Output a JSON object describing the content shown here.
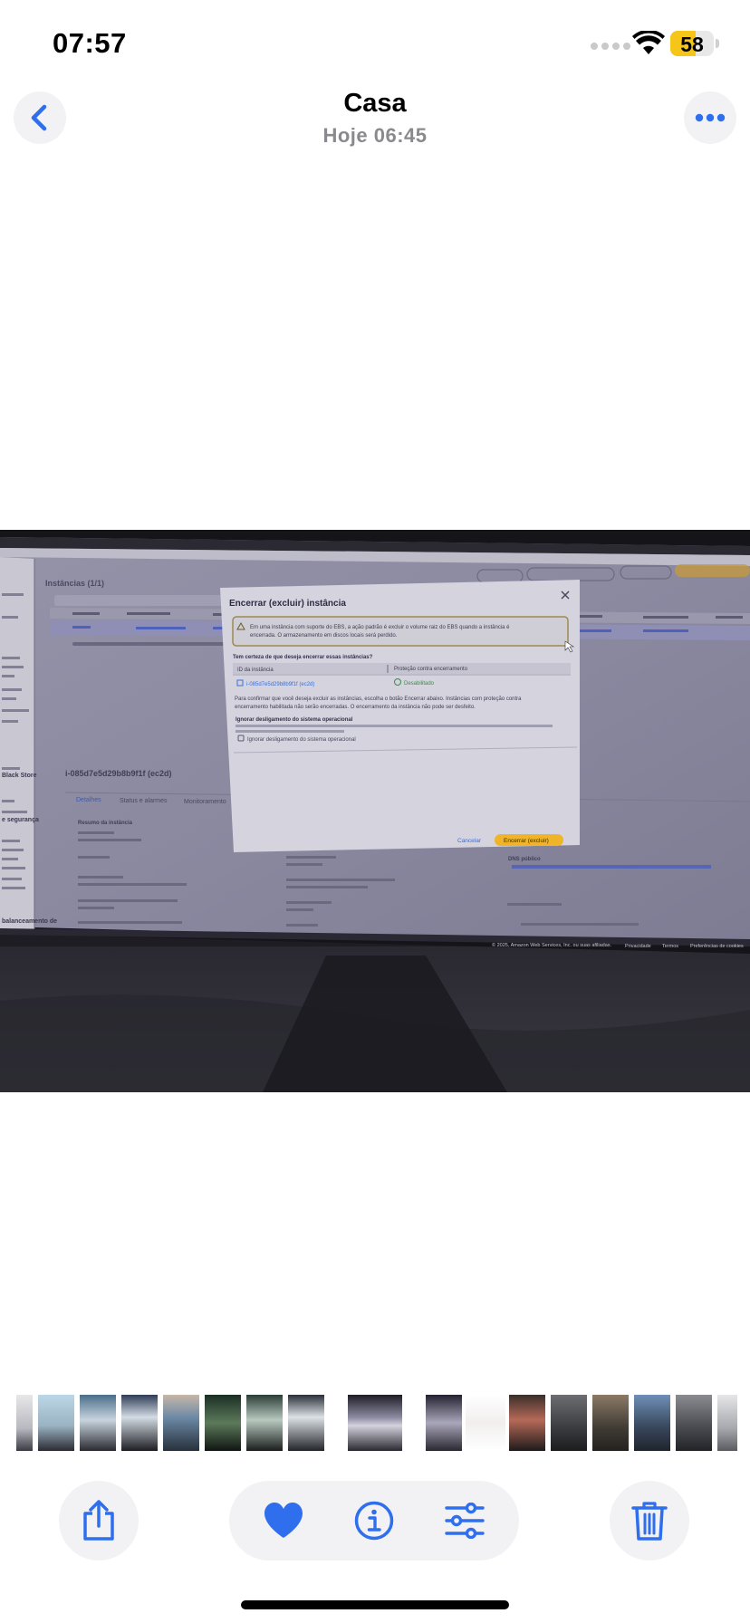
{
  "status_bar": {
    "time": "07:57",
    "battery_level": "58",
    "battery_fraction": 0.58
  },
  "nav": {
    "title": "Casa",
    "subtitle": "Hoje  06:45",
    "back_icon": "chevron-left-icon",
    "more_icon": "ellipsis-icon"
  },
  "photo": {
    "dialog_title": "Encerrar (excluir) instância",
    "warning_text_1": "Em uma instância com suporte do EBS, a ação padrão é excluir o volume raiz do EBS quando a instância é",
    "warning_text_2": "encerrada. O armazenamento em discos locais será perdido.",
    "question": "Tem certeza de que deseja encerrar essas instâncias?",
    "col_id": "ID da instância",
    "col_protection": "Proteção contra encerramento",
    "instance_id": "i-085d7e5d29b8b9f1f (ec2d)",
    "protection_value": "Desabilitado",
    "confirm_text_1": "Para confirmar que você deseja excluir as instâncias, escolha o botão Encerrar abaixo. Instâncias com proteção contra",
    "confirm_text_2": "encerramento habilitada não serão encerradas. O encerramento da instância não pode ser desfeito.",
    "shutdown_heading": "Ignorar desligamento do sistema operacional",
    "shutdown_checkbox": "Ignorar desligamento do sistema operacional",
    "cancel_label": "Cancelar",
    "terminate_label": "Encerrar (excluir)",
    "bg_panel_title": "Instâncias (1/1)",
    "bg_instance_heading": "i-085d7e5d29b8b9f1f (ec2d)",
    "bg_tab_details": "Detalhes",
    "bg_tab_status": "Status e alarmes",
    "bg_tab_monitoring": "Monitoramento",
    "bg_summary": "Resumo da instância",
    "bg_dns": "DNS público",
    "bg_footer": "© 2025, Amazon Web Services, Inc. ou suas afiliadas.",
    "bg_footer_privacy": "Privacidade",
    "bg_footer_terms": "Termos",
    "bg_footer_cookies": "Preferências de cookies",
    "bg_sidebar_1": "Black Store",
    "bg_sidebar_2": "e segurança",
    "bg_sidebar_3": "balanceamento de",
    "accent_orange": "#f5b731",
    "link_blue": "#3b6fd6"
  },
  "thumbnails": {
    "count": 17
  },
  "toolbar": {
    "share_icon": "share-icon",
    "favorite_icon": "heart-icon",
    "info_icon": "info-icon",
    "adjust_icon": "sliders-icon",
    "delete_icon": "trash-icon",
    "accent": "#2f6fed"
  }
}
